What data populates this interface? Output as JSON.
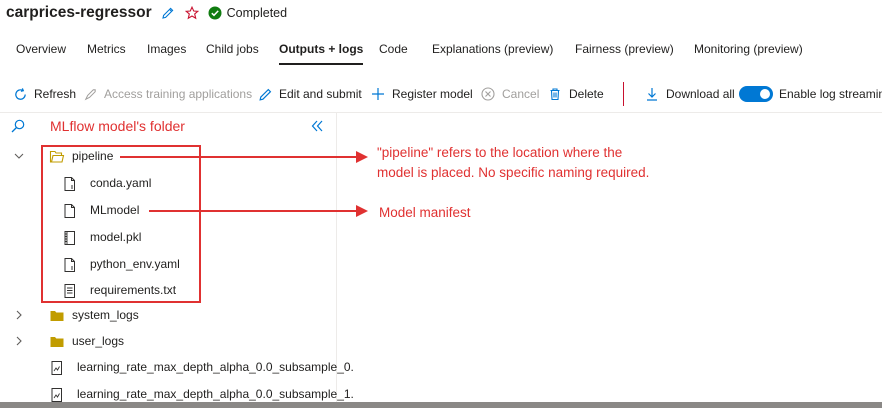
{
  "run": {
    "title": "carprices-regressor",
    "status": "Completed",
    "edit_icon": "pencil-icon",
    "favorite_icon": "star-icon",
    "status_icon": "check-circle-icon",
    "colors": {
      "accent": "#0078d4",
      "success": "#107c10",
      "annotation": "#e03131"
    }
  },
  "tabs": [
    {
      "label": "Overview"
    },
    {
      "label": "Metrics"
    },
    {
      "label": "Images"
    },
    {
      "label": "Child jobs"
    },
    {
      "label": "Outputs + logs",
      "active": true
    },
    {
      "label": "Code"
    },
    {
      "label": "Explanations (preview)"
    },
    {
      "label": "Fairness (preview)"
    },
    {
      "label": "Monitoring (preview)"
    }
  ],
  "toolbar": {
    "refresh": "Refresh",
    "access_training": "Access training applications",
    "edit_submit": "Edit and submit",
    "register_model": "Register model",
    "cancel": "Cancel",
    "delete": "Delete",
    "download_all": "Download all",
    "log_streaming": "Enable log streaming",
    "log_streaming_on": true
  },
  "panel": {
    "label": "MLflow model's folder",
    "search_icon": "search-icon",
    "collapse_icon": "double-chevron-left-icon"
  },
  "tree": {
    "pipeline": "pipeline",
    "conda": "conda.yaml",
    "mlmodel": "MLmodel",
    "model_pkl": "model.pkl",
    "python_env": "python_env.yaml",
    "requirements": "requirements.txt",
    "system_logs": "system_logs",
    "user_logs": "user_logs",
    "lr_file_0": "learning_rate_max_depth_alpha_0.0_subsample_0.",
    "lr_file_1": "learning_rate_max_depth_alpha_0.0_subsample_1."
  },
  "annotations": {
    "pipeline_note_line1": "\"pipeline\" refers to the location where the",
    "pipeline_note_line2": "model is placed. No specific naming required.",
    "mlmodel_note": "Model manifest"
  }
}
